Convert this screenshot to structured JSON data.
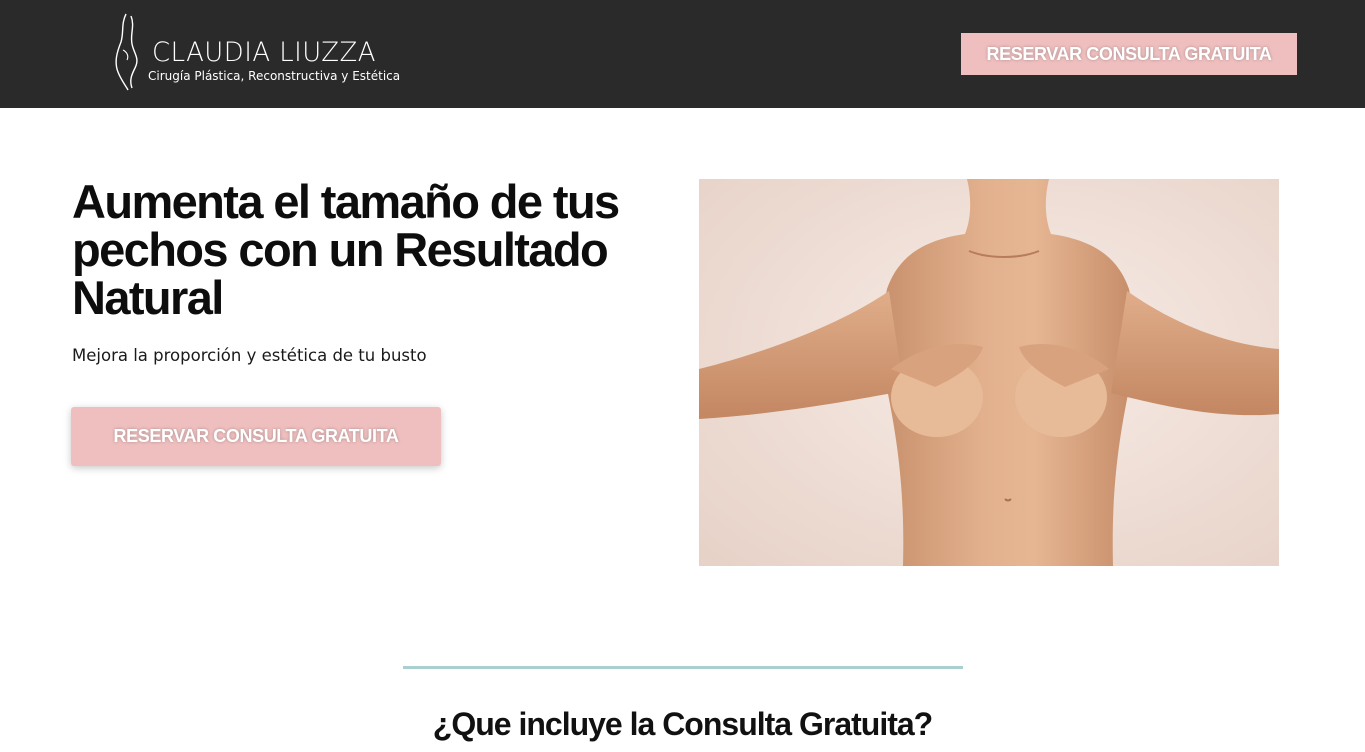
{
  "header": {
    "brand_name": "CLAUDIA LIUZZA",
    "brand_tagline": "Cirugía Plástica, Reconstructiva y Estética",
    "cta_label": "RESERVAR CONSULTA GRATUITA",
    "logo_icon": "silhouette-logo-icon"
  },
  "hero": {
    "title": "Aumenta el tamaño de tus pechos con un Resultado Natural",
    "subtitle": "Mejora la proporción y estética de tu busto",
    "cta_label": "RESERVAR CONSULTA GRATUITA",
    "image_subject": "torso-photo"
  },
  "section": {
    "title": "¿Que incluye la Consulta Gratuita?"
  },
  "colors": {
    "header_bg": "#2a2a2a",
    "cta_bg": "#efbfbf",
    "divider": "#a9cfcf",
    "text": "#111111"
  }
}
